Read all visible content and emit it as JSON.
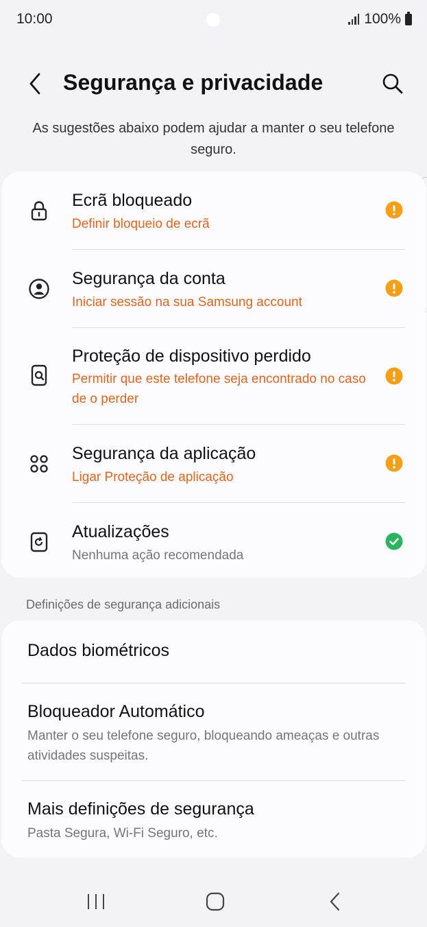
{
  "status_bar": {
    "time": "10:00",
    "battery_text": "100%",
    "icons": [
      "camera-cutout",
      "signal-icon",
      "battery-icon"
    ]
  },
  "header": {
    "title": "Segurança e privacidade",
    "back_icon": "chevron-left-icon",
    "search_icon": "search-icon"
  },
  "intro": "As sugestões abaixo podem ajudar a manter o seu telefone seguro.",
  "security_items": [
    {
      "title": "Ecrã bloqueado",
      "subtitle": "Definir bloqueio de ecrã",
      "icon": "lock-icon",
      "status": "warning"
    },
    {
      "title": "Segurança da conta",
      "subtitle": "Iniciar sessão na sua Samsung account",
      "icon": "account-icon",
      "status": "warning"
    },
    {
      "title": "Proteção de dispositivo perdido",
      "subtitle": "Permitir que este telefone seja encontrado no caso de o perder",
      "icon": "find-device-icon",
      "status": "warning"
    },
    {
      "title": "Segurança da aplicação",
      "subtitle": "Ligar Proteção de aplicação",
      "icon": "apps-icon",
      "status": "warning"
    },
    {
      "title": "Atualizações",
      "subtitle": "Nenhuma ação recomendada",
      "icon": "update-icon",
      "status": "ok"
    }
  ],
  "additional": {
    "section_label": "Definições de segurança adicionais",
    "items": [
      {
        "title": "Dados biométricos",
        "subtitle": ""
      },
      {
        "title": "Bloqueador Automático",
        "subtitle": "Manter o seu telefone seguro, bloqueando ameaças e outras atividades suspeitas."
      },
      {
        "title": "Mais definições de segurança",
        "subtitle": "Pasta Segura, Wi-Fi Seguro, etc."
      }
    ]
  },
  "nav_bar": {
    "icons": [
      "recent-apps-icon",
      "home-icon",
      "back-icon"
    ]
  },
  "colors": {
    "background": "#f3f2f7",
    "card": "#fcfcff",
    "warning_text": "#e2631c",
    "warning_badge": "#f59f17",
    "ok_badge": "#2ab45e"
  }
}
